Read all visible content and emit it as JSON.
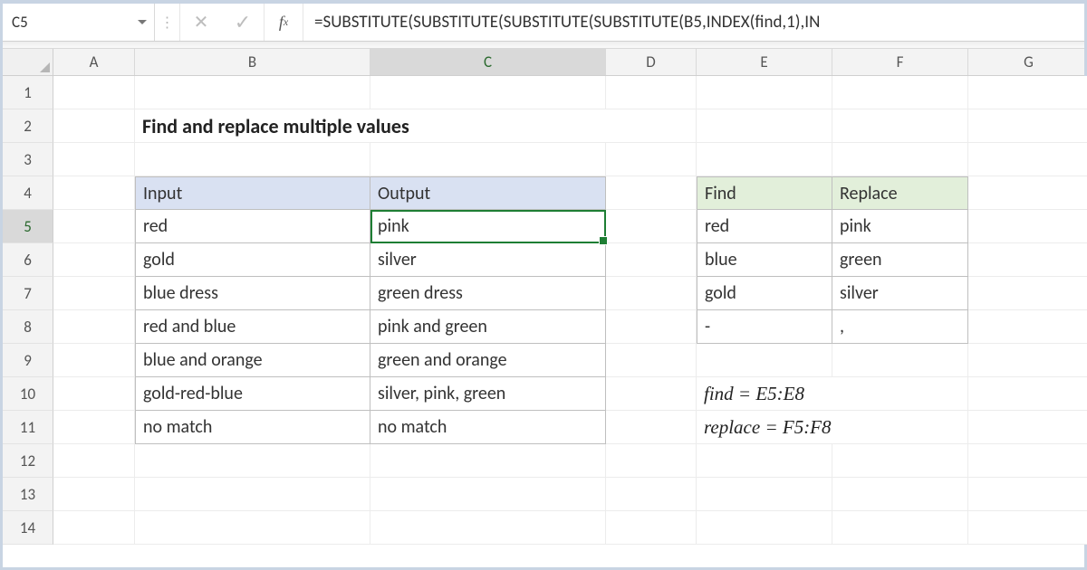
{
  "name_box": "C5",
  "formula": "=SUBSTITUTE(SUBSTITUTE(SUBSTITUTE(SUBSTITUTE(B5,INDEX(find,1),IN",
  "columns": [
    "A",
    "B",
    "C",
    "D",
    "E",
    "F",
    "G"
  ],
  "active_column": "C",
  "row_labels": [
    "1",
    "2",
    "3",
    "4",
    "5",
    "6",
    "7",
    "8",
    "9",
    "10",
    "11",
    "12",
    "13",
    "14"
  ],
  "active_row": "5",
  "title": "Find and replace multiple values",
  "table1": {
    "headers": [
      "Input",
      "Output"
    ],
    "rows": [
      [
        "red",
        "pink"
      ],
      [
        "gold",
        "silver"
      ],
      [
        "blue dress",
        "green dress"
      ],
      [
        "red and blue",
        "pink and green"
      ],
      [
        "blue and orange",
        "green and orange"
      ],
      [
        "gold-red-blue",
        "silver, pink, green"
      ],
      [
        "no match",
        "no match"
      ]
    ]
  },
  "table2": {
    "headers": [
      "Find",
      "Replace"
    ],
    "rows": [
      [
        "red",
        "pink"
      ],
      [
        "blue",
        "green"
      ],
      [
        "gold",
        "silver"
      ],
      [
        "-",
        ","
      ]
    ]
  },
  "notes": {
    "n1": "find = E5:E8",
    "n2": "replace = F5:F8"
  }
}
